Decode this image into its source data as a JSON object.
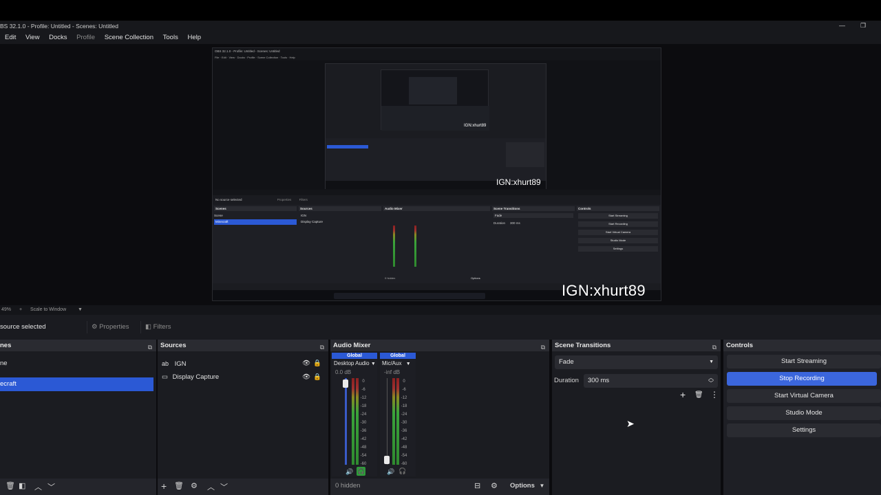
{
  "window": {
    "title": "BS 32.1.0 - Profile: Untitled - Scenes: Untitled",
    "minimize_glyph": "—",
    "restore_glyph": "❐"
  },
  "menu": {
    "items": [
      "Edit",
      "View",
      "Docks",
      "Profile",
      "Scene Collection",
      "Tools",
      "Help"
    ]
  },
  "preview": {
    "overlay_tag_large": "IGN:xhurt89",
    "overlay_tag_mid": "IGN:xhurt89",
    "overlay_tag_small": "IGN:xhurt89",
    "nested_title": "OBS 32.1.0 - Profile: Untitled - Scenes: Untitled",
    "nested_no_source": "No source selected",
    "nested_properties": "Properties",
    "nested_filters": "Filters",
    "nested_docks": {
      "scenes": "Scenes",
      "sources": "Sources",
      "audio_mixer": "Audio Mixer",
      "scene_transitions": "Scene Transitions",
      "controls": "Controls"
    },
    "nested_scenes": [
      "Scene",
      "Minecraft"
    ],
    "nested_sources": [
      "IGN",
      "Display Capture"
    ],
    "nested_transition": "Fade",
    "nested_duration_label": "Duration",
    "nested_duration_value": "300 ms",
    "nested_controls": [
      "Start Streaming",
      "Start Recording",
      "Start Virtual Camera",
      "Studio Mode",
      "Settings"
    ],
    "nested_hidden": "0 hidden",
    "nested_options": "Options"
  },
  "zoombar": {
    "zoom": "49%",
    "scale_mode": "Scale to Window"
  },
  "context_bar": {
    "no_source": "source selected",
    "properties": "Properties",
    "filters": "Filters"
  },
  "scenes": {
    "title": "nes",
    "items": [
      "ne",
      "ecraft"
    ],
    "selected_index": 1
  },
  "sources": {
    "title": "Sources",
    "items": [
      "IGN",
      "Display Capture"
    ]
  },
  "audio_mixer": {
    "title": "Audio Mixer",
    "channels": [
      {
        "tag": "Global",
        "name": "Desktop Audio",
        "level": "0.0 dB"
      },
      {
        "tag": "Global",
        "name": "Mic/Aux",
        "level": "-inf dB"
      }
    ],
    "scale": [
      "0",
      "-6",
      "-12",
      "-18",
      "-24",
      "-30",
      "-36",
      "-42",
      "-48",
      "-54",
      "-60"
    ],
    "hidden_count": "0 hidden",
    "options_label": "Options"
  },
  "scene_transitions": {
    "title": "Scene Transitions",
    "transition": "Fade",
    "duration_label": "Duration",
    "duration_value": "300 ms"
  },
  "controls": {
    "title": "Controls",
    "buttons": [
      "Start Streaming",
      "Stop Recording",
      "Start Virtual Camera",
      "Studio Mode",
      "Settings"
    ],
    "active_index": 1
  },
  "colors": {
    "accent": "#2b59d5",
    "recording_button": "#3b66dc",
    "panel_bg": "#1e1f25",
    "header_bg": "#2a2b31"
  }
}
